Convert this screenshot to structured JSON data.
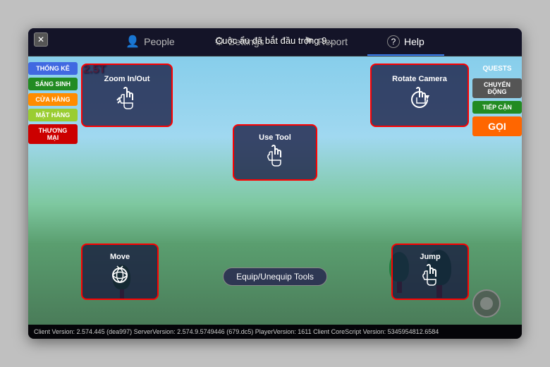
{
  "window": {
    "close_label": "✕"
  },
  "nav": {
    "items": [
      {
        "id": "people",
        "label": "People",
        "icon": "👤",
        "active": false
      },
      {
        "id": "settings",
        "label": "Settings",
        "icon": "⚙",
        "active": false
      },
      {
        "id": "report",
        "label": "Report",
        "icon": "⚑",
        "active": false
      },
      {
        "id": "help",
        "label": "Help",
        "icon": "?",
        "active": true
      }
    ]
  },
  "notification": {
    "text": "Cuộc ẩu đã bắt đầu trong 9..."
  },
  "left_sidebar": {
    "items": [
      {
        "label": "THỐNG KÊ",
        "color": "blue"
      },
      {
        "label": "SÁNG SINH",
        "color": "green"
      },
      {
        "label": "CỬA HÀNG",
        "color": "orange"
      },
      {
        "label": "MẶT HÀNG",
        "color": "yellow-green"
      },
      {
        "label": "THƯƠNG MẠI",
        "color": "red"
      }
    ]
  },
  "right_sidebar": {
    "header": "QUESTS",
    "items": [
      {
        "label": "CHUYỂN ĐỘNG",
        "color": "gray"
      },
      {
        "label": "TIẾP CẬN",
        "color": "green"
      },
      {
        "label": "GỌI",
        "color": "btn-go"
      }
    ]
  },
  "controls": {
    "zoom": {
      "label": "Zoom In/Out",
      "icon": "☛"
    },
    "rotate": {
      "label": "Rotate Camera",
      "icon": "☚"
    },
    "use_tool": {
      "label": "Use Tool",
      "icon": "☛"
    },
    "equip": {
      "label": "Equip/Unequip Tools"
    },
    "move": {
      "label": "Move",
      "icon": "↺"
    },
    "jump": {
      "label": "Jump",
      "icon": "☛"
    }
  },
  "score": {
    "value": "2.5T"
  },
  "status_bar": {
    "text": "Client Version: 2.574.445 (dea997)   ServerVersion: 2.574.9.5749446 (679.dc5)   PlayerVersion: 1611   Client CoreScript Version: 5345954812.6584"
  }
}
